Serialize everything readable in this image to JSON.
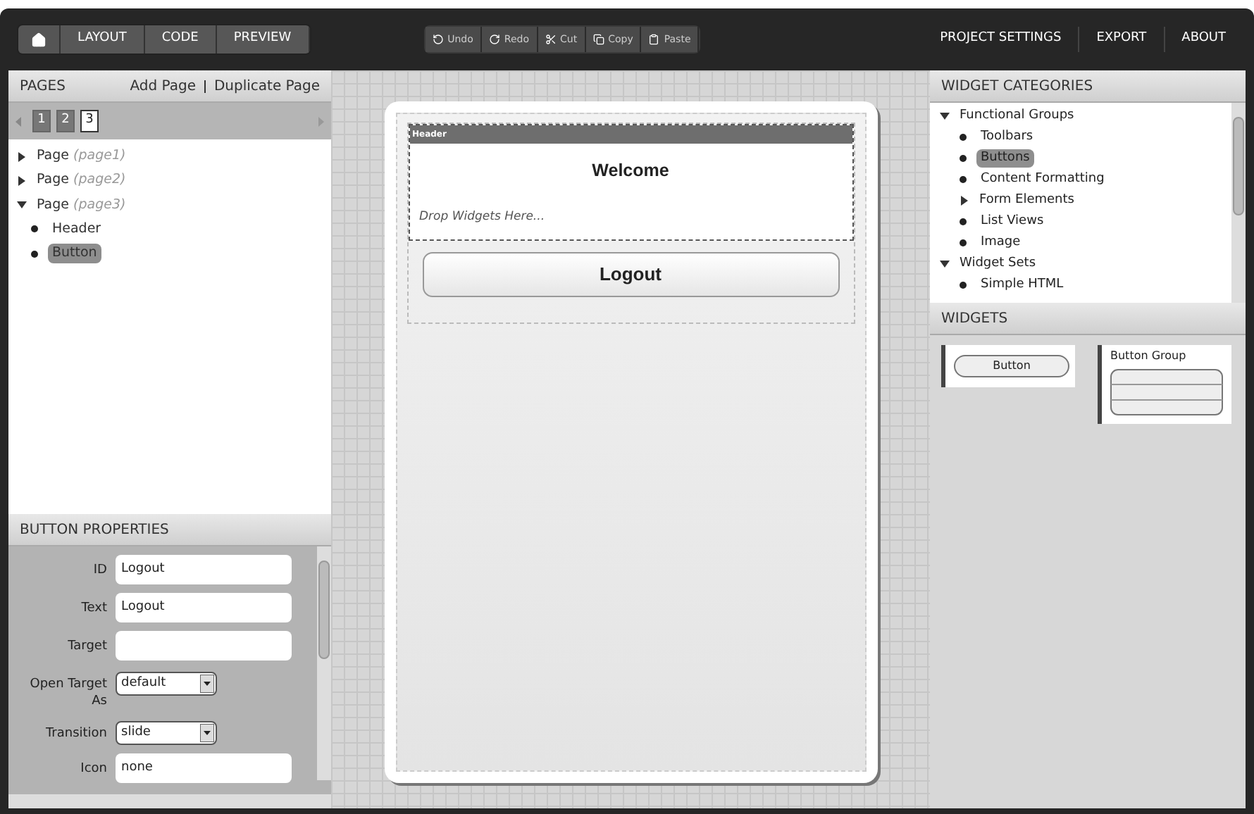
{
  "nav_tabs": [
    {
      "kind": "home"
    },
    {
      "kind": "text",
      "label": "LAYOUT"
    },
    {
      "kind": "text",
      "label": "CODE"
    },
    {
      "kind": "text",
      "label": "PREVIEW"
    }
  ],
  "edit_buttons": [
    {
      "kind": "undo",
      "label": "Undo"
    },
    {
      "kind": "redo",
      "label": "Redo"
    },
    {
      "kind": "cut",
      "label": "Cut"
    },
    {
      "kind": "copy",
      "label": "Copy"
    },
    {
      "kind": "paste",
      "label": "Paste"
    }
  ],
  "top_links": [
    "PROJECT SETTINGS",
    "EXPORT",
    "ABOUT"
  ],
  "pages_panel": {
    "title": "PAGES",
    "actions": [
      "Add Page",
      "Duplicate Page"
    ],
    "page_tabs": [
      {
        "label": "1",
        "selected": false
      },
      {
        "label": "2",
        "selected": false
      },
      {
        "label": "3",
        "selected": true
      }
    ],
    "tree": [
      {
        "label": "Page",
        "id": "(page1)",
        "expanded": false
      },
      {
        "label": "Page",
        "id": "(page2)",
        "expanded": false
      },
      {
        "label": "Page",
        "id": "(page3)",
        "expanded": true,
        "children": [
          {
            "label": "Header",
            "selected": false
          },
          {
            "label": "Button",
            "selected": true
          }
        ]
      }
    ]
  },
  "properties": {
    "title": "BUTTON PROPERTIES",
    "fields": [
      {
        "label": "ID",
        "kind": "text",
        "value": "Logout"
      },
      {
        "label": "Text",
        "kind": "text",
        "value": "Logout"
      },
      {
        "label": "Target",
        "kind": "text"
      },
      {
        "label": "Open Target As",
        "kind": "select",
        "value": "default"
      },
      {
        "label": "Transition",
        "kind": "select",
        "value": "slide"
      },
      {
        "label": "Icon",
        "kind": "text",
        "value": "none"
      }
    ]
  },
  "canvas": {
    "header_label": "Header",
    "title": "Welcome",
    "drop_hint": "Drop Widgets Here...",
    "button": "Logout"
  },
  "categories": {
    "title": "WIDGET CATEGORIES",
    "tree": [
      {
        "label": "Functional Groups",
        "expanded": true,
        "children": [
          {
            "label": "Toolbars",
            "selected": false
          },
          {
            "label": "Buttons",
            "selected": true
          },
          {
            "label": "Content Formatting",
            "selected": false
          },
          {
            "label": "Form Elements",
            "expanded": false
          },
          {
            "label": "List Views",
            "selected": false
          },
          {
            "label": "Image",
            "selected": false
          }
        ]
      },
      {
        "label": "Widget Sets",
        "expanded": true,
        "children": [
          {
            "label": "Simple HTML",
            "selected": false
          }
        ]
      }
    ]
  },
  "widgets": {
    "title": "WIDGETS",
    "items": [
      {
        "kind": "button",
        "label": "Button"
      },
      {
        "kind": "button_group",
        "label": "Button Group"
      }
    ]
  }
}
